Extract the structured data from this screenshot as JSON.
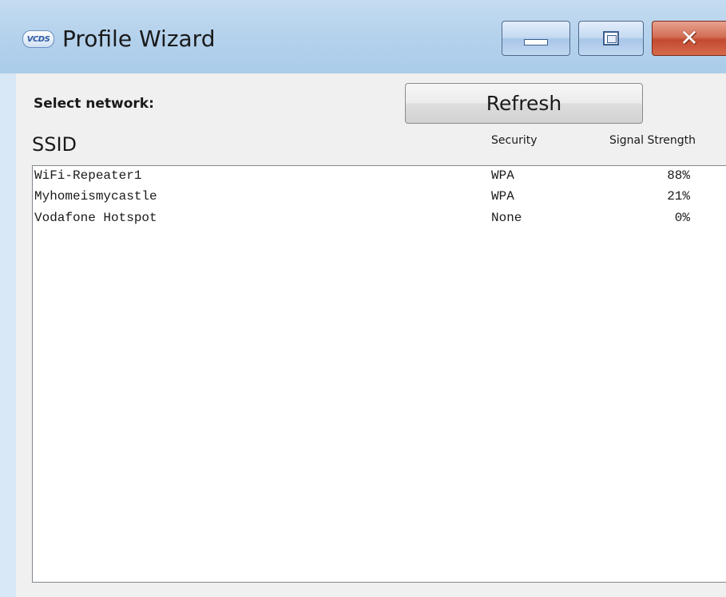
{
  "window": {
    "title": "Profile Wizard",
    "app_icon_text": "VCDS"
  },
  "header": {
    "select_label": "Select network:",
    "refresh_label": "Refresh"
  },
  "columns": {
    "ssid": "SSID",
    "security": "Security",
    "signal": "Signal Strength"
  },
  "networks": [
    {
      "ssid": "WiFi-Repeater1",
      "security": "WPA",
      "signal": "88%"
    },
    {
      "ssid": "Myhomeismycastle",
      "security": "WPA",
      "signal": "21%"
    },
    {
      "ssid": "Vodafone Hotspot",
      "security": "None",
      "signal": "0%"
    }
  ],
  "colors": {
    "frame": "#b6d2ec",
    "close_button": "#c24a30",
    "dialog_bg": "#f0f0f0"
  }
}
